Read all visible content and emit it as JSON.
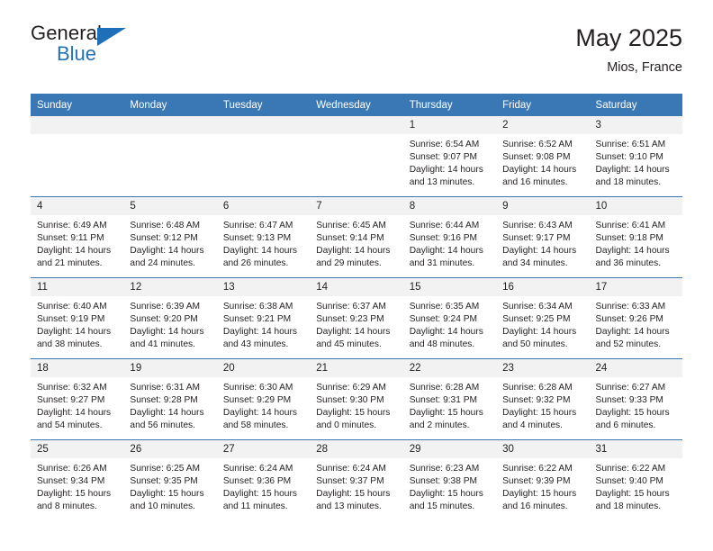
{
  "brand": {
    "name_line1": "General",
    "name_line2": "Blue",
    "triangle_color": "#1f6fb8"
  },
  "header": {
    "title": "May 2025",
    "location": "Mios, France",
    "accent_color": "#3a78b5"
  },
  "weekdays": [
    "Sunday",
    "Monday",
    "Tuesday",
    "Wednesday",
    "Thursday",
    "Friday",
    "Saturday"
  ],
  "weeks": [
    [
      {
        "day": "",
        "sunrise": "",
        "sunset": "",
        "daylight1": "",
        "daylight2": ""
      },
      {
        "day": "",
        "sunrise": "",
        "sunset": "",
        "daylight1": "",
        "daylight2": ""
      },
      {
        "day": "",
        "sunrise": "",
        "sunset": "",
        "daylight1": "",
        "daylight2": ""
      },
      {
        "day": "",
        "sunrise": "",
        "sunset": "",
        "daylight1": "",
        "daylight2": ""
      },
      {
        "day": "1",
        "sunrise": "Sunrise: 6:54 AM",
        "sunset": "Sunset: 9:07 PM",
        "daylight1": "Daylight: 14 hours",
        "daylight2": "and 13 minutes."
      },
      {
        "day": "2",
        "sunrise": "Sunrise: 6:52 AM",
        "sunset": "Sunset: 9:08 PM",
        "daylight1": "Daylight: 14 hours",
        "daylight2": "and 16 minutes."
      },
      {
        "day": "3",
        "sunrise": "Sunrise: 6:51 AM",
        "sunset": "Sunset: 9:10 PM",
        "daylight1": "Daylight: 14 hours",
        "daylight2": "and 18 minutes."
      }
    ],
    [
      {
        "day": "4",
        "sunrise": "Sunrise: 6:49 AM",
        "sunset": "Sunset: 9:11 PM",
        "daylight1": "Daylight: 14 hours",
        "daylight2": "and 21 minutes."
      },
      {
        "day": "5",
        "sunrise": "Sunrise: 6:48 AM",
        "sunset": "Sunset: 9:12 PM",
        "daylight1": "Daylight: 14 hours",
        "daylight2": "and 24 minutes."
      },
      {
        "day": "6",
        "sunrise": "Sunrise: 6:47 AM",
        "sunset": "Sunset: 9:13 PM",
        "daylight1": "Daylight: 14 hours",
        "daylight2": "and 26 minutes."
      },
      {
        "day": "7",
        "sunrise": "Sunrise: 6:45 AM",
        "sunset": "Sunset: 9:14 PM",
        "daylight1": "Daylight: 14 hours",
        "daylight2": "and 29 minutes."
      },
      {
        "day": "8",
        "sunrise": "Sunrise: 6:44 AM",
        "sunset": "Sunset: 9:16 PM",
        "daylight1": "Daylight: 14 hours",
        "daylight2": "and 31 minutes."
      },
      {
        "day": "9",
        "sunrise": "Sunrise: 6:43 AM",
        "sunset": "Sunset: 9:17 PM",
        "daylight1": "Daylight: 14 hours",
        "daylight2": "and 34 minutes."
      },
      {
        "day": "10",
        "sunrise": "Sunrise: 6:41 AM",
        "sunset": "Sunset: 9:18 PM",
        "daylight1": "Daylight: 14 hours",
        "daylight2": "and 36 minutes."
      }
    ],
    [
      {
        "day": "11",
        "sunrise": "Sunrise: 6:40 AM",
        "sunset": "Sunset: 9:19 PM",
        "daylight1": "Daylight: 14 hours",
        "daylight2": "and 38 minutes."
      },
      {
        "day": "12",
        "sunrise": "Sunrise: 6:39 AM",
        "sunset": "Sunset: 9:20 PM",
        "daylight1": "Daylight: 14 hours",
        "daylight2": "and 41 minutes."
      },
      {
        "day": "13",
        "sunrise": "Sunrise: 6:38 AM",
        "sunset": "Sunset: 9:21 PM",
        "daylight1": "Daylight: 14 hours",
        "daylight2": "and 43 minutes."
      },
      {
        "day": "14",
        "sunrise": "Sunrise: 6:37 AM",
        "sunset": "Sunset: 9:23 PM",
        "daylight1": "Daylight: 14 hours",
        "daylight2": "and 45 minutes."
      },
      {
        "day": "15",
        "sunrise": "Sunrise: 6:35 AM",
        "sunset": "Sunset: 9:24 PM",
        "daylight1": "Daylight: 14 hours",
        "daylight2": "and 48 minutes."
      },
      {
        "day": "16",
        "sunrise": "Sunrise: 6:34 AM",
        "sunset": "Sunset: 9:25 PM",
        "daylight1": "Daylight: 14 hours",
        "daylight2": "and 50 minutes."
      },
      {
        "day": "17",
        "sunrise": "Sunrise: 6:33 AM",
        "sunset": "Sunset: 9:26 PM",
        "daylight1": "Daylight: 14 hours",
        "daylight2": "and 52 minutes."
      }
    ],
    [
      {
        "day": "18",
        "sunrise": "Sunrise: 6:32 AM",
        "sunset": "Sunset: 9:27 PM",
        "daylight1": "Daylight: 14 hours",
        "daylight2": "and 54 minutes."
      },
      {
        "day": "19",
        "sunrise": "Sunrise: 6:31 AM",
        "sunset": "Sunset: 9:28 PM",
        "daylight1": "Daylight: 14 hours",
        "daylight2": "and 56 minutes."
      },
      {
        "day": "20",
        "sunrise": "Sunrise: 6:30 AM",
        "sunset": "Sunset: 9:29 PM",
        "daylight1": "Daylight: 14 hours",
        "daylight2": "and 58 minutes."
      },
      {
        "day": "21",
        "sunrise": "Sunrise: 6:29 AM",
        "sunset": "Sunset: 9:30 PM",
        "daylight1": "Daylight: 15 hours",
        "daylight2": "and 0 minutes."
      },
      {
        "day": "22",
        "sunrise": "Sunrise: 6:28 AM",
        "sunset": "Sunset: 9:31 PM",
        "daylight1": "Daylight: 15 hours",
        "daylight2": "and 2 minutes."
      },
      {
        "day": "23",
        "sunrise": "Sunrise: 6:28 AM",
        "sunset": "Sunset: 9:32 PM",
        "daylight1": "Daylight: 15 hours",
        "daylight2": "and 4 minutes."
      },
      {
        "day": "24",
        "sunrise": "Sunrise: 6:27 AM",
        "sunset": "Sunset: 9:33 PM",
        "daylight1": "Daylight: 15 hours",
        "daylight2": "and 6 minutes."
      }
    ],
    [
      {
        "day": "25",
        "sunrise": "Sunrise: 6:26 AM",
        "sunset": "Sunset: 9:34 PM",
        "daylight1": "Daylight: 15 hours",
        "daylight2": "and 8 minutes."
      },
      {
        "day": "26",
        "sunrise": "Sunrise: 6:25 AM",
        "sunset": "Sunset: 9:35 PM",
        "daylight1": "Daylight: 15 hours",
        "daylight2": "and 10 minutes."
      },
      {
        "day": "27",
        "sunrise": "Sunrise: 6:24 AM",
        "sunset": "Sunset: 9:36 PM",
        "daylight1": "Daylight: 15 hours",
        "daylight2": "and 11 minutes."
      },
      {
        "day": "28",
        "sunrise": "Sunrise: 6:24 AM",
        "sunset": "Sunset: 9:37 PM",
        "daylight1": "Daylight: 15 hours",
        "daylight2": "and 13 minutes."
      },
      {
        "day": "29",
        "sunrise": "Sunrise: 6:23 AM",
        "sunset": "Sunset: 9:38 PM",
        "daylight1": "Daylight: 15 hours",
        "daylight2": "and 15 minutes."
      },
      {
        "day": "30",
        "sunrise": "Sunrise: 6:22 AM",
        "sunset": "Sunset: 9:39 PM",
        "daylight1": "Daylight: 15 hours",
        "daylight2": "and 16 minutes."
      },
      {
        "day": "31",
        "sunrise": "Sunrise: 6:22 AM",
        "sunset": "Sunset: 9:40 PM",
        "daylight1": "Daylight: 15 hours",
        "daylight2": "and 18 minutes."
      }
    ]
  ]
}
